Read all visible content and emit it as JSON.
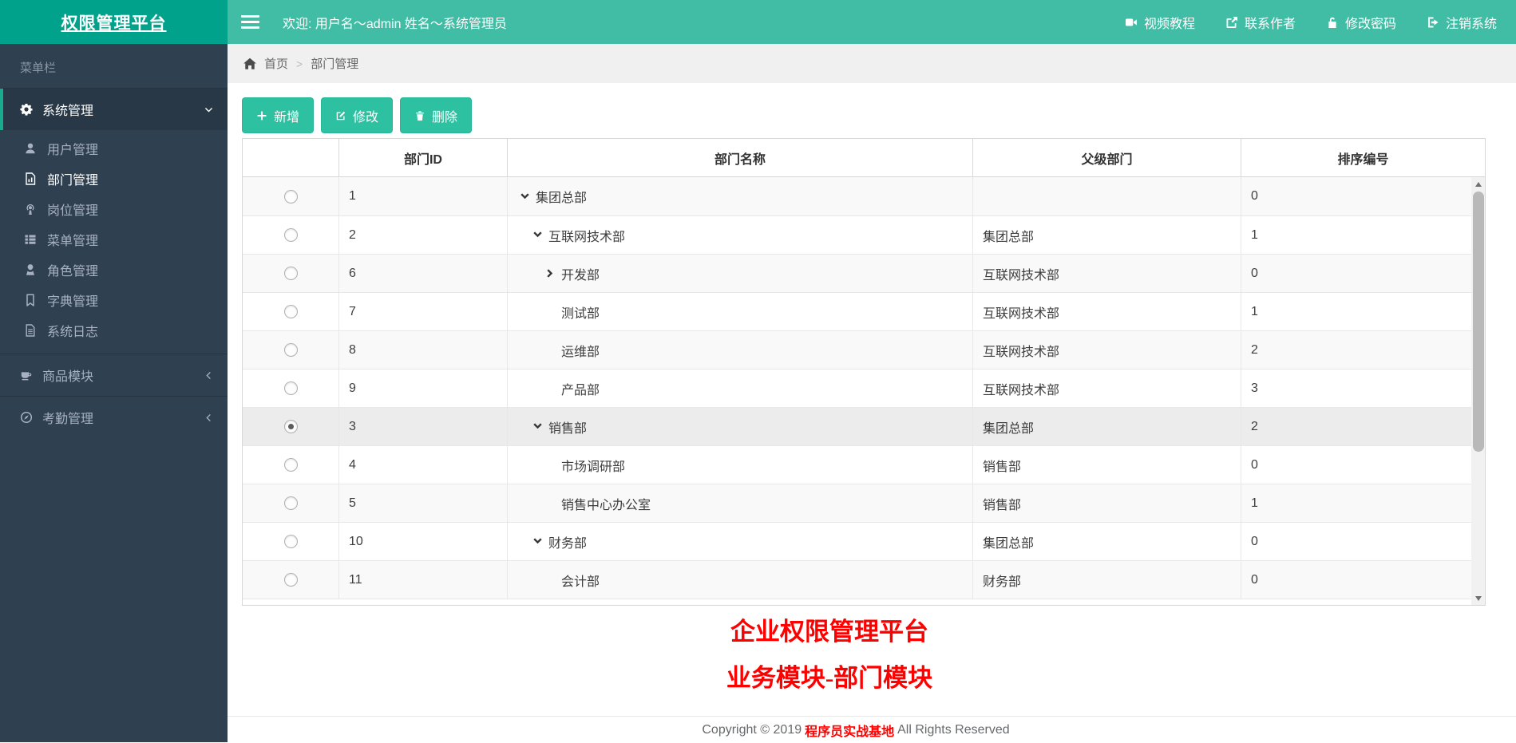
{
  "app": {
    "title": "权限管理平台"
  },
  "topbar": {
    "welcome": "欢迎: 用户名～admin  姓名～系统管理员",
    "links": [
      {
        "key": "video-tutorial",
        "icon": "i-video",
        "label": "视频教程"
      },
      {
        "key": "contact-author",
        "icon": "i-external",
        "label": "联系作者"
      },
      {
        "key": "change-password",
        "icon": "i-unlock",
        "label": "修改密码"
      },
      {
        "key": "logout",
        "icon": "i-signout",
        "label": "注销系统"
      }
    ]
  },
  "sidebar": {
    "header": "菜单栏",
    "sections": [
      {
        "key": "system-management",
        "label": "系统管理",
        "icon": "i-gear",
        "expanded": true,
        "active": true,
        "children": [
          {
            "key": "user-management",
            "label": "用户管理",
            "icon": "i-user",
            "active": false
          },
          {
            "key": "department-management",
            "label": "部门管理",
            "icon": "i-dept",
            "active": true
          },
          {
            "key": "post-management",
            "label": "岗位管理",
            "icon": "i-post",
            "active": false
          },
          {
            "key": "menu-management",
            "label": "菜单管理",
            "icon": "i-menu",
            "active": false
          },
          {
            "key": "role-management",
            "label": "角色管理",
            "icon": "i-role",
            "active": false
          },
          {
            "key": "dict-management",
            "label": "字典管理",
            "icon": "i-dict",
            "active": false
          },
          {
            "key": "system-log",
            "label": "系统日志",
            "icon": "i-log",
            "active": false
          }
        ]
      },
      {
        "key": "goods-module",
        "label": "商品模块",
        "icon": "i-goods",
        "expanded": false,
        "children": []
      },
      {
        "key": "attendance-management",
        "label": "考勤管理",
        "icon": "i-attend",
        "expanded": false,
        "children": []
      }
    ]
  },
  "breadcrumb": {
    "home": "首页",
    "separator": ">",
    "current": "部门管理"
  },
  "toolbar": {
    "buttons": [
      {
        "key": "add",
        "icon": "i-plus",
        "label": "新增"
      },
      {
        "key": "edit",
        "icon": "i-edit",
        "label": "修改"
      },
      {
        "key": "delete",
        "icon": "i-trash",
        "label": "删除"
      }
    ]
  },
  "table": {
    "columns": [
      "",
      "部门ID",
      "部门名称",
      "父级部门",
      "排序编号"
    ],
    "rows": [
      {
        "id": "1",
        "name": "集团总部",
        "level": 0,
        "caret": "down",
        "parent": "",
        "order": "0",
        "selected": false
      },
      {
        "id": "2",
        "name": "互联网技术部",
        "level": 1,
        "caret": "down",
        "parent": "集团总部",
        "order": "1",
        "selected": false
      },
      {
        "id": "6",
        "name": "开发部",
        "level": 2,
        "caret": "right",
        "parent": "互联网技术部",
        "order": "0",
        "selected": false
      },
      {
        "id": "7",
        "name": "测试部",
        "level": 2,
        "caret": "none",
        "parent": "互联网技术部",
        "order": "1",
        "selected": false
      },
      {
        "id": "8",
        "name": "运维部",
        "level": 2,
        "caret": "none",
        "parent": "互联网技术部",
        "order": "2",
        "selected": false
      },
      {
        "id": "9",
        "name": "产品部",
        "level": 2,
        "caret": "none",
        "parent": "互联网技术部",
        "order": "3",
        "selected": false
      },
      {
        "id": "3",
        "name": "销售部",
        "level": 1,
        "caret": "down",
        "parent": "集团总部",
        "order": "2",
        "selected": true
      },
      {
        "id": "4",
        "name": "市场调研部",
        "level": 2,
        "caret": "none",
        "parent": "销售部",
        "order": "0",
        "selected": false
      },
      {
        "id": "5",
        "name": "销售中心办公室",
        "level": 2,
        "caret": "none",
        "parent": "销售部",
        "order": "1",
        "selected": false
      },
      {
        "id": "10",
        "name": "财务部",
        "level": 1,
        "caret": "down",
        "parent": "集团总部",
        "order": "0",
        "selected": false
      },
      {
        "id": "11",
        "name": "会计部",
        "level": 2,
        "caret": "none",
        "parent": "财务部",
        "order": "0",
        "selected": false
      }
    ]
  },
  "footer": {
    "banner_line1": "企业权限管理平台",
    "banner_line2": "业务模块-部门模块",
    "copyright_prefix": "Copyright ©  2019 ",
    "copyright_brand": "程序员实战基地",
    "copyright_suffix": " All Rights Reserved"
  },
  "colors": {
    "logo_bg": "#00a28b",
    "topbar_bg": "#41bda6",
    "accent_button": "#2dc1a2",
    "sidebar_bg": "#2f4050",
    "active_indicator": "#19aa8d",
    "banner_red": "#ff0000"
  }
}
